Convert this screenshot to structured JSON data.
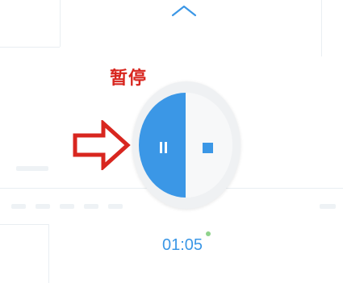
{
  "annotation": {
    "label": "暂停",
    "color": "#d8261f"
  },
  "control": {
    "pause_icon": "pause-icon",
    "stop_icon": "stop-icon",
    "accent": "#3b97e6"
  },
  "header": {
    "collapse_icon": "chevron-up-icon"
  },
  "recording": {
    "elapsed": "01:05",
    "status_dot_color": "#8fd38c"
  }
}
